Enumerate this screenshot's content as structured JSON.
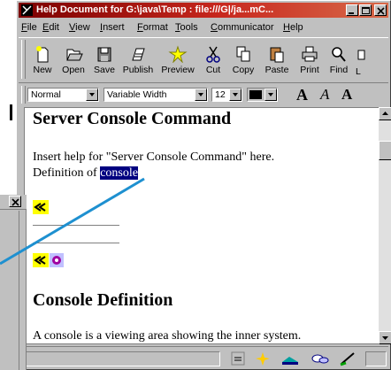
{
  "window": {
    "title": "Help Document for G:\\java\\Temp : file:///G|/ja...mC..."
  },
  "menu": [
    "File",
    "Edit",
    "View",
    "Insert",
    "Format",
    "Tools",
    "Communicator",
    "Help"
  ],
  "toolbar": [
    {
      "label": "New",
      "icon": "new-doc-icon"
    },
    {
      "label": "Open",
      "icon": "open-icon"
    },
    {
      "label": "Save",
      "icon": "save-icon"
    },
    {
      "label": "Publish",
      "icon": "publish-icon"
    },
    {
      "label": "Preview",
      "icon": "preview-icon"
    },
    {
      "label": "Cut",
      "icon": "cut-icon"
    },
    {
      "label": "Copy",
      "icon": "copy-icon"
    },
    {
      "label": "Paste",
      "icon": "paste-icon"
    },
    {
      "label": "Print",
      "icon": "print-icon"
    },
    {
      "label": "Find",
      "icon": "find-icon"
    },
    {
      "label": "L",
      "icon": "link-icon"
    }
  ],
  "format": {
    "paragraph_style": "Normal",
    "font": "Variable Width",
    "size": "12",
    "a_large": "A",
    "a_italic": "A",
    "a_bold": "A"
  },
  "content": {
    "heading1": "Server Console Command",
    "para1": "Insert help for \"Server Console Command\" here.",
    "def_prefix": "Definition of ",
    "def_selected": "console",
    "heading2": "Console Definition",
    "para2": "A console is a viewing area showing the inner system."
  },
  "colors": {
    "titlebar": "#a01010",
    "selection": "#000080",
    "pointer_line": "#1e90d0"
  }
}
